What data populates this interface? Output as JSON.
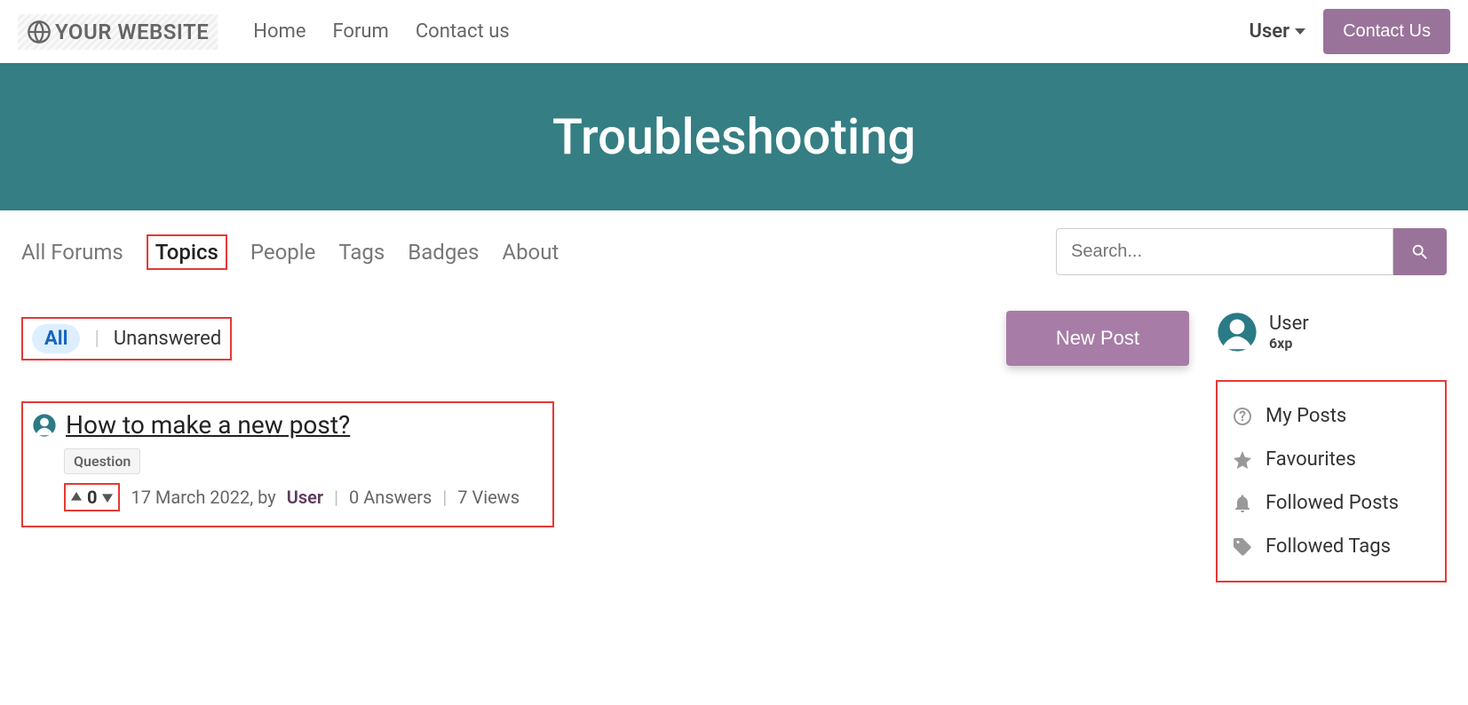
{
  "logo": {
    "text": "YOUR WEBSITE"
  },
  "topnav": {
    "home": "Home",
    "forum": "Forum",
    "contact": "Contact us"
  },
  "usermenu": {
    "username": "User",
    "contact_btn": "Contact Us"
  },
  "banner": {
    "title": "Troubleshooting"
  },
  "subnav": {
    "all_forums": "All Forums",
    "topics": "Topics",
    "people": "People",
    "tags": "Tags",
    "badges": "Badges",
    "about": "About"
  },
  "search": {
    "placeholder": "Search..."
  },
  "filters": {
    "all": "All",
    "unanswered": "Unanswered"
  },
  "new_post_btn": "New Post",
  "post": {
    "title": "How to make a new post?",
    "tag": "Question",
    "votes": "0",
    "date": "17 March 2022, by",
    "author": "User",
    "answers": "0 Answers",
    "views": "7 Views"
  },
  "sidebar_user": {
    "name": "User",
    "xp": "6xp"
  },
  "sidebar_links": {
    "my_posts": "My Posts",
    "favourites": "Favourites",
    "followed_posts": "Followed Posts",
    "followed_tags": "Followed Tags"
  }
}
